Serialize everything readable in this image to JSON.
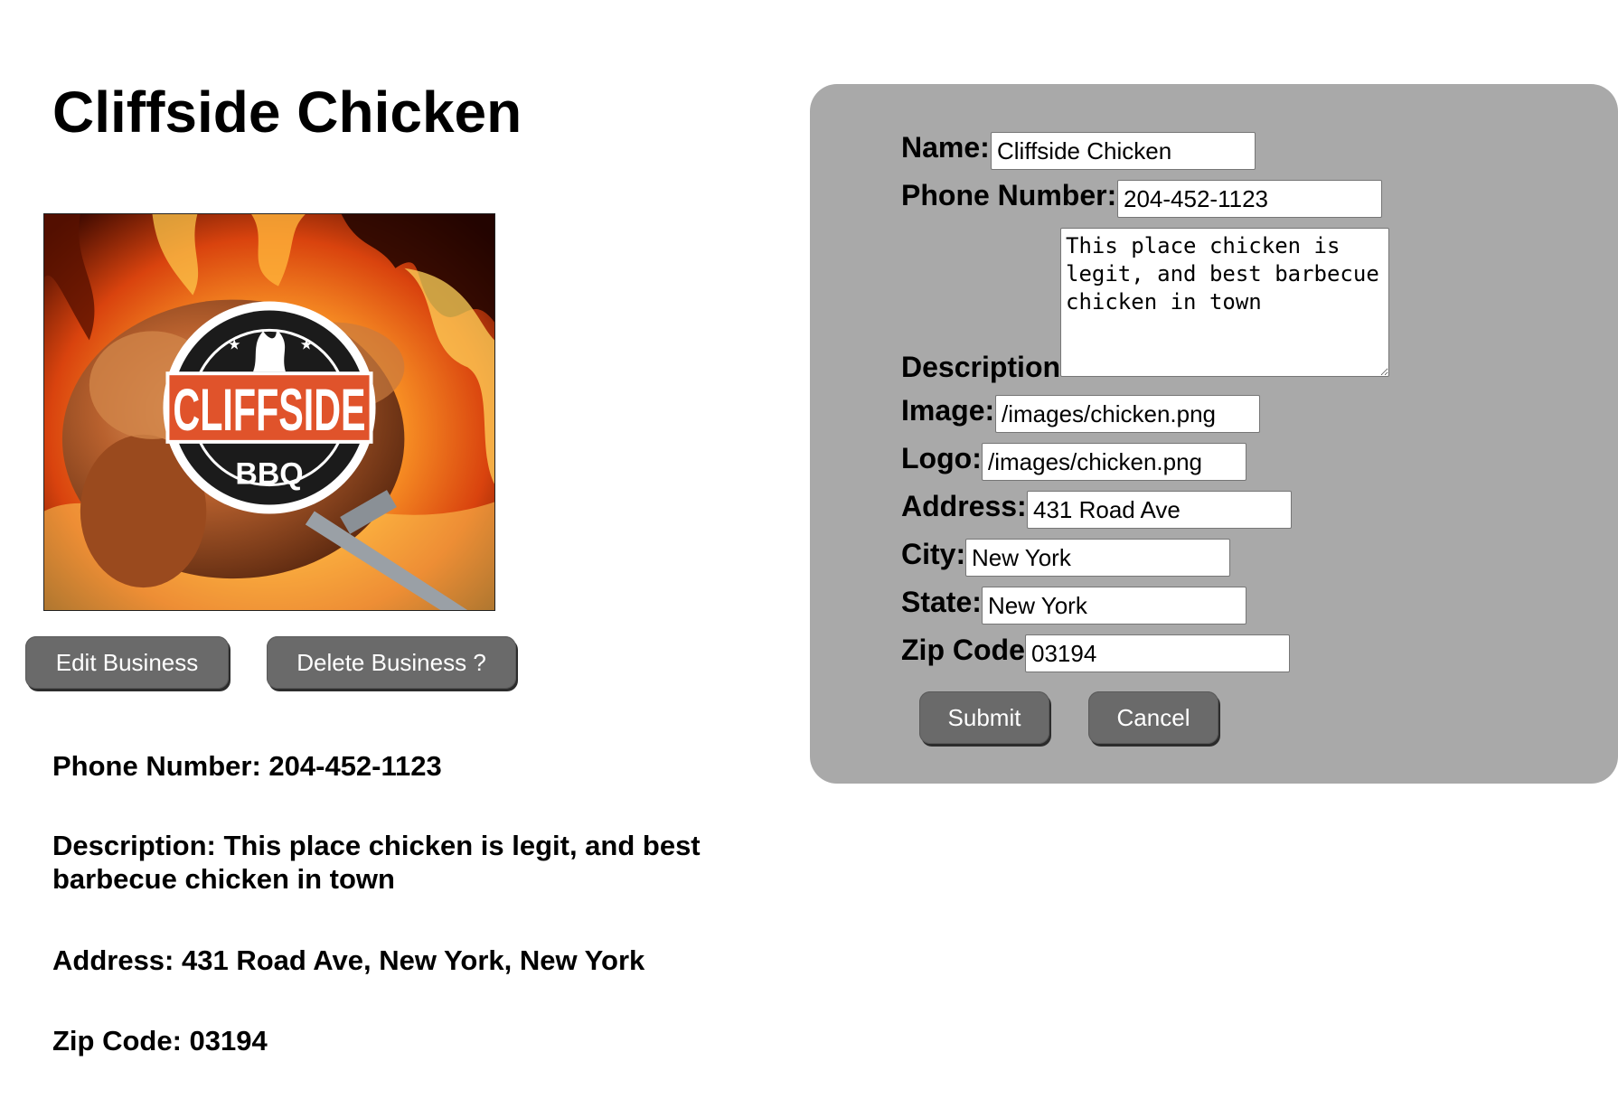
{
  "business": {
    "title": "Cliffside Chicken",
    "image_alt": "Cliffside chicken image",
    "logo_text_top": "CLIFFSIDE",
    "logo_text_bottom": "BBQ"
  },
  "actions": {
    "edit_label": "Edit Business",
    "delete_label": "Delete Business ?"
  },
  "details": {
    "phone": "Phone Number: 204-452-1123",
    "description": "Description: This place chicken is legit, and best barbecue chicken in town",
    "address": "Address: 431 Road Ave, New York, New York",
    "zip": "Zip Code: 03194"
  },
  "form": {
    "name_label": "Name:",
    "name_value": "Cliffside Chicken",
    "phone_label": "Phone Number:",
    "phone_value": "204-452-1123",
    "description_label": "Description",
    "description_value": "This place chicken is legit, and best barbecue chicken in town",
    "image_label": "Image:",
    "image_value": "/images/chicken.png",
    "logo_label": "Logo:",
    "logo_value": "/images/chicken.png",
    "address_label": "Address:",
    "address_value": "431 Road Ave",
    "city_label": "City:",
    "city_value": "New York",
    "state_label": "State:",
    "state_value": "New York",
    "zip_label": "Zip Code",
    "zip_value": "03194",
    "submit_label": "Submit",
    "cancel_label": "Cancel"
  },
  "colors": {
    "panel_bg": "#a9a9a9",
    "button_bg": "#6a6a6a",
    "button_text": "#ffffff",
    "logo_red": "#e0532b"
  }
}
